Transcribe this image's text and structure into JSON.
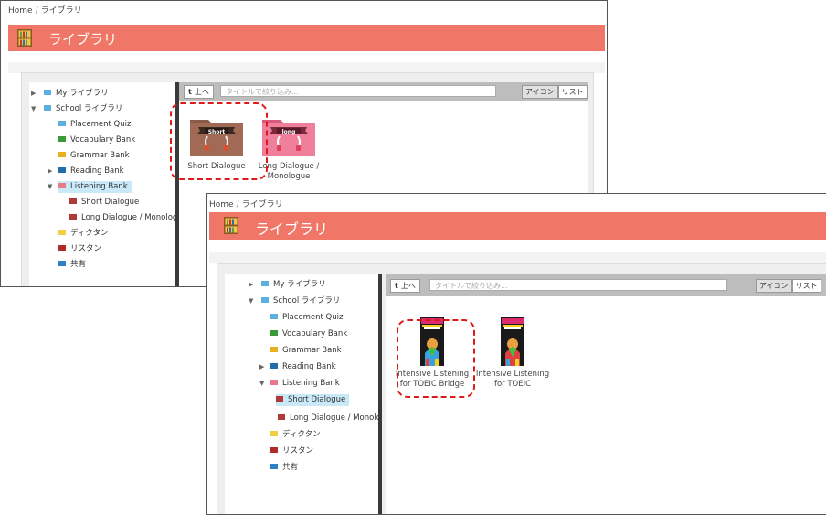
{
  "window1": {
    "breadcrumb": {
      "home": "Home",
      "sep": "/",
      "current": "ライブラリ"
    },
    "title": "ライブラリ",
    "tree": {
      "my_library": "My ライブラリ",
      "school_library": "School ライブラリ",
      "placement_quiz": "Placement Quiz",
      "vocabulary_bank": "Vocabulary Bank",
      "grammar_bank": "Grammar Bank",
      "reading_bank": "Reading Bank",
      "listening_bank": "Listening Bank",
      "short_dialogue": "Short Dialogue",
      "long_dialogue": "Long Dialogue / Monologue",
      "dictation": "ディクタン",
      "listan": "リスタン",
      "shared": "共有"
    },
    "toolbar": {
      "up_icon": "t",
      "up_label": "上へ",
      "search_placeholder": "タイトルで絞り込み...",
      "icon_view": "アイコン",
      "list_view": "リスト"
    },
    "items": [
      {
        "icon_label": "Short",
        "label": "Short Dialogue"
      },
      {
        "icon_label": "long",
        "label": "Long Dialogue /",
        "label2": "Monologue"
      }
    ]
  },
  "window2": {
    "breadcrumb": {
      "home": "Home",
      "sep": "/",
      "current": "ライブラリ"
    },
    "title": "ライブラリ",
    "tree": {
      "my_library": "My ライブラリ",
      "school_library": "School ライブラリ",
      "placement_quiz": "Placement Quiz",
      "vocabulary_bank": "Vocabulary Bank",
      "grammar_bank": "Grammar Bank",
      "reading_bank": "Reading Bank",
      "listening_bank": "Listening Bank",
      "short_dialogue": "Short Dialogue",
      "long_dialogue": "Long Dialogue / Monologue",
      "dictation": "ディクタン",
      "listan": "リスタン",
      "shared": "共有"
    },
    "toolbar": {
      "up_icon": "t",
      "up_label": "上へ",
      "search_placeholder": "タイトルで絞り込み...",
      "icon_view": "アイコン",
      "list_view": "リスト"
    },
    "items": [
      {
        "label": "Intensive Listening",
        "label2": "for TOEIC Bridge"
      },
      {
        "label": "Intensive Listening",
        "label2": "for TOEIC"
      }
    ]
  },
  "colors": {
    "title_bar": "#f07767",
    "highlight_dash": "#dd1a1a",
    "selected_item": "#c9e9f9"
  }
}
